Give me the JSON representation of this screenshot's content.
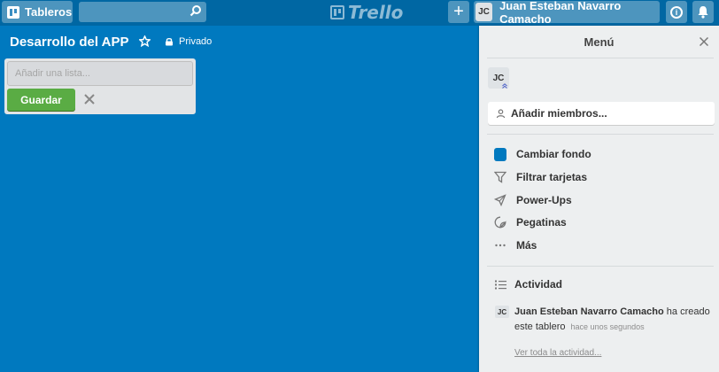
{
  "header": {
    "boards_label": "Tableros",
    "logo_text": "Trello",
    "add_label": "+",
    "user_initials": "JC",
    "user_name": "Juan Esteban Navarro Camacho"
  },
  "board": {
    "title": "Desarrollo del APP",
    "visibility": "Privado",
    "background_color": "#0079bf"
  },
  "composer": {
    "placeholder": "Añadir una lista...",
    "save_label": "Guardar"
  },
  "menu": {
    "title": "Menú",
    "member_initials": "JC",
    "add_members_label": "Añadir miembros...",
    "items": [
      {
        "label": "Cambiar fondo",
        "icon": "background-swatch-icon"
      },
      {
        "label": "Filtrar tarjetas",
        "icon": "filter-icon"
      },
      {
        "label": "Power-Ups",
        "icon": "rocket-icon"
      },
      {
        "label": "Pegatinas",
        "icon": "sticker-icon"
      },
      {
        "label": "Más",
        "icon": "more-icon"
      }
    ],
    "activity": {
      "heading": "Actividad",
      "entry": {
        "initials": "JC",
        "user": "Juan Esteban Navarro Camacho",
        "action": "ha creado este tablero",
        "time": "hace unos segundos"
      },
      "see_all": "Ver toda la actividad..."
    }
  }
}
